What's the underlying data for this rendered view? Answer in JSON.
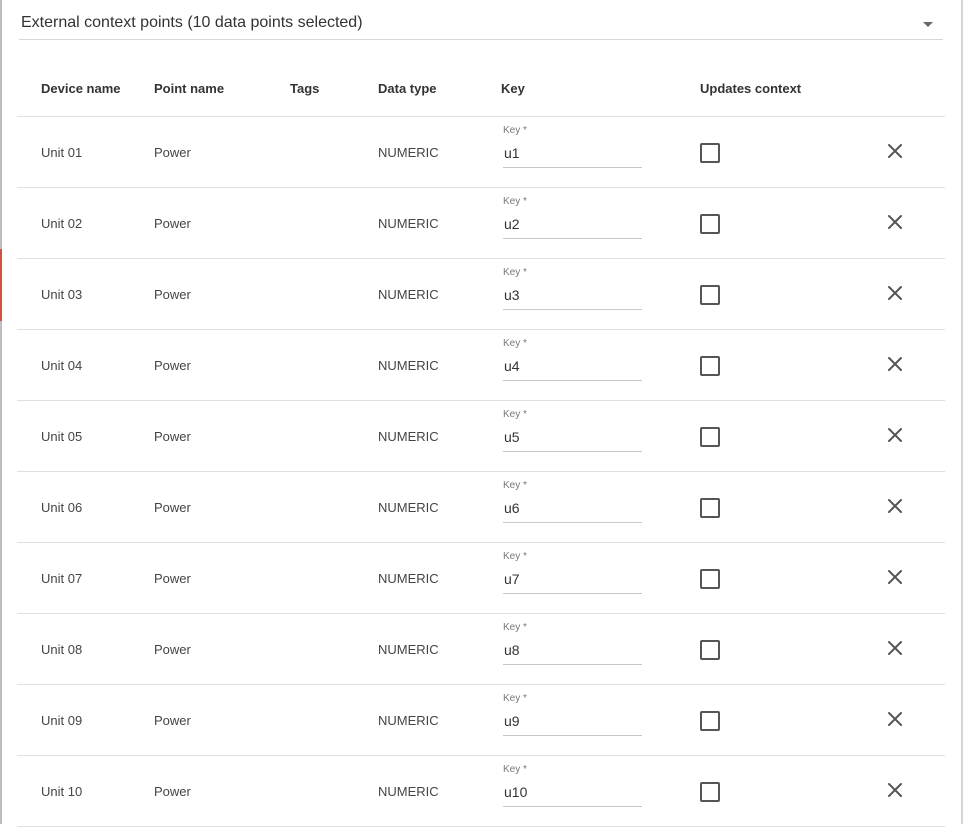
{
  "selector": {
    "text": "External context points (10 data points selected)",
    "icon": "chevron-down-icon"
  },
  "table": {
    "headers": {
      "device_name": "Device name",
      "point_name": "Point name",
      "tags": "Tags",
      "data_type": "Data type",
      "key": "Key",
      "updates_context": "Updates context"
    },
    "key_field_label": "Key *",
    "rows": [
      {
        "device": "Unit 01",
        "point": "Power",
        "tags": "",
        "type": "NUMERIC",
        "key": "u1",
        "updates_context": false
      },
      {
        "device": "Unit 02",
        "point": "Power",
        "tags": "",
        "type": "NUMERIC",
        "key": "u2",
        "updates_context": false
      },
      {
        "device": "Unit 03",
        "point": "Power",
        "tags": "",
        "type": "NUMERIC",
        "key": "u3",
        "updates_context": false
      },
      {
        "device": "Unit 04",
        "point": "Power",
        "tags": "",
        "type": "NUMERIC",
        "key": "u4",
        "updates_context": false
      },
      {
        "device": "Unit 05",
        "point": "Power",
        "tags": "",
        "type": "NUMERIC",
        "key": "u5",
        "updates_context": false
      },
      {
        "device": "Unit 06",
        "point": "Power",
        "tags": "",
        "type": "NUMERIC",
        "key": "u6",
        "updates_context": false
      },
      {
        "device": "Unit 07",
        "point": "Power",
        "tags": "",
        "type": "NUMERIC",
        "key": "u7",
        "updates_context": false
      },
      {
        "device": "Unit 08",
        "point": "Power",
        "tags": "",
        "type": "NUMERIC",
        "key": "u8",
        "updates_context": false
      },
      {
        "device": "Unit 09",
        "point": "Power",
        "tags": "",
        "type": "NUMERIC",
        "key": "u9",
        "updates_context": false
      },
      {
        "device": "Unit 10",
        "point": "Power",
        "tags": "",
        "type": "NUMERIC",
        "key": "u10",
        "updates_context": false
      }
    ],
    "remove_icon": "close-icon"
  }
}
